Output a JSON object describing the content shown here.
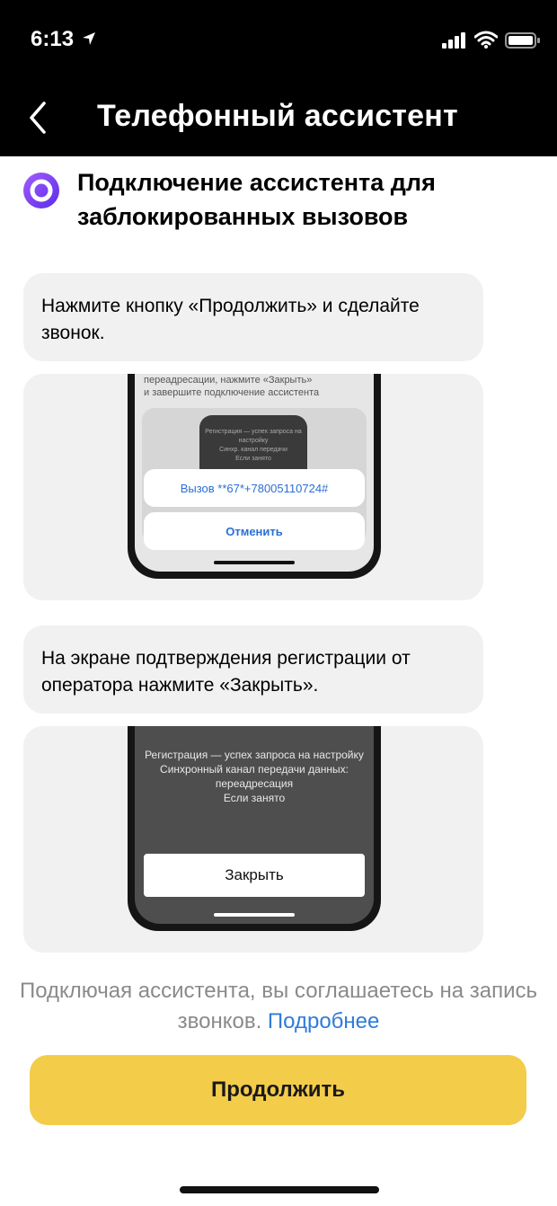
{
  "status_bar": {
    "time": "6:13"
  },
  "nav": {
    "title": "Телефонный ассистент"
  },
  "section": {
    "title": "Подключение ассистента для заблокированных вызовов"
  },
  "steps": [
    {
      "text": "Нажмите кнопку «Продолжить» и сделайте звонок.",
      "preview": {
        "caption_line1": "переадресации, нажмите «Закрыть»",
        "caption_line2": "и завершите подключение ассистента",
        "inner_line1": "Регистрация — успех запроса на настройку",
        "inner_line2": "Синхр. канал передачи",
        "inner_line3": "Если занято",
        "call_button": "Вызов **67*+78005110724#",
        "cancel_button": "Отменить"
      }
    },
    {
      "text": "На экране подтверждения регистрации от оператора нажмите «Закрыть».",
      "preview": {
        "line1": "Регистрация — успех запроса на настройку",
        "line2": "Синхронный канал передачи данных:",
        "line3": "переадресация",
        "line4": "Если занято",
        "close_button": "Закрыть"
      }
    }
  ],
  "consent": {
    "text": "Подключая ассистента, вы соглашаетесь на запись звонков.",
    "link": "Подробнее"
  },
  "continue_button": "Продолжить",
  "colors": {
    "accent_yellow": "#f3cc4a",
    "link_blue": "#2f7bd8",
    "alice_purple": "#7b3ff2",
    "card_bg": "#f1f1f1"
  },
  "icons": [
    "location-arrow-icon",
    "signal-icon",
    "wifi-icon",
    "battery-icon",
    "back-chevron-icon",
    "alice-icon"
  ]
}
